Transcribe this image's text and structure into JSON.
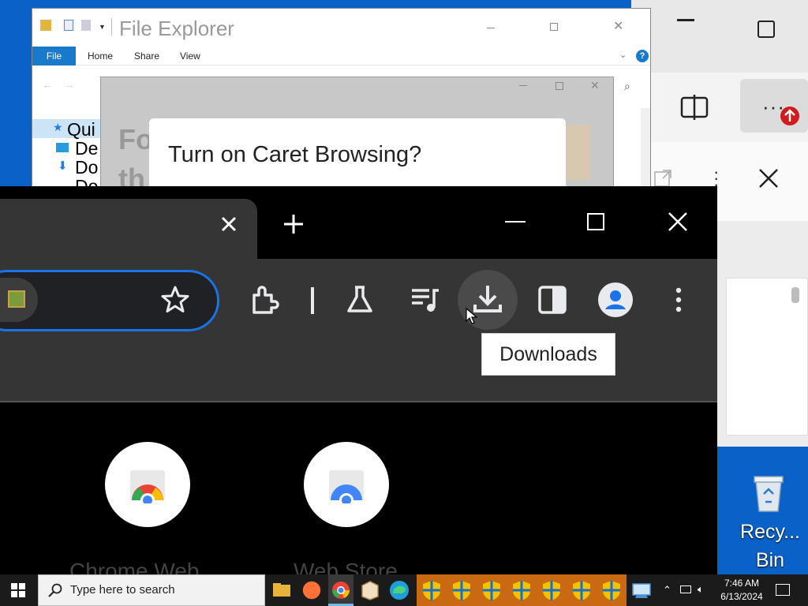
{
  "file_explorer": {
    "title": "File Explorer",
    "tabs": [
      "File",
      "Home",
      "Share",
      "View"
    ],
    "nav_items": [
      "Qui",
      "De",
      "Do",
      "Do"
    ]
  },
  "dialog": {
    "title": "Turn on Caret Browsing?",
    "background_text": [
      "Fo",
      "th"
    ]
  },
  "chrome": {
    "tooltip": "Downloads",
    "shortcuts": [
      "Chrome Web",
      "Web Store"
    ]
  },
  "desktop": {
    "recycle_bin": [
      "Recy...",
      "Bin"
    ]
  },
  "taskbar": {
    "search_placeholder": "Type here to search",
    "time": "7:46 AM",
    "date": "6/13/2024"
  }
}
